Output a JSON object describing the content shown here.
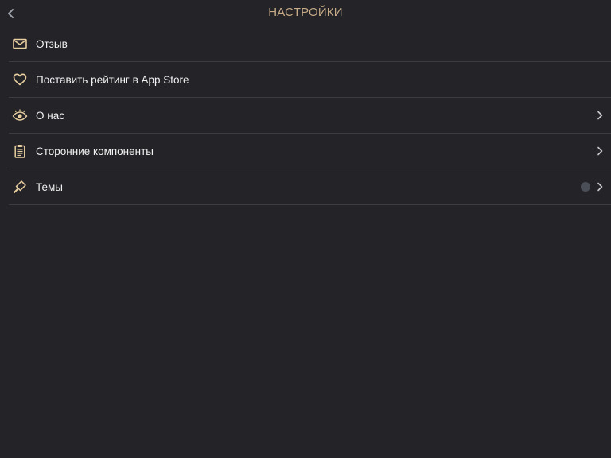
{
  "navbar": {
    "title": "НАСТРОЙКИ",
    "back_icon": "chevron-left-icon"
  },
  "colors": {
    "background": "#232328",
    "accent": "#c7ab88",
    "icon": "#e8cfa0",
    "text": "#f2f2f2",
    "separator": "#3c3c42",
    "theme_dot": "#4a4e57"
  },
  "rows": [
    {
      "label": "Отзыв",
      "icon": "envelope-icon",
      "has_chevron": false
    },
    {
      "label": "Поставить рейтинг в App Store",
      "icon": "heart-icon",
      "has_chevron": false
    },
    {
      "label": "О нас",
      "icon": "eye-icon",
      "has_chevron": true
    },
    {
      "label": "Сторонние компоненты",
      "icon": "clipboard-icon",
      "has_chevron": true
    },
    {
      "label": "Темы",
      "icon": "paintbrush-icon",
      "has_chevron": true,
      "has_dot": true
    }
  ]
}
